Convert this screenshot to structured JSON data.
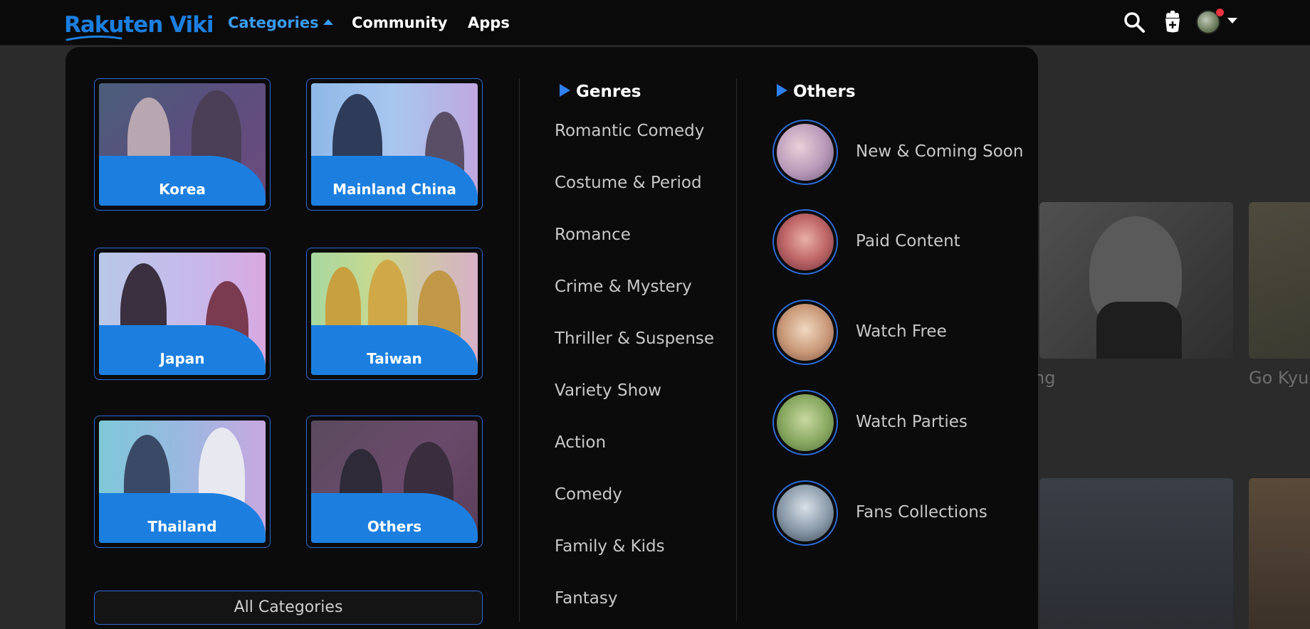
{
  "navbar": {
    "logo": "Rakuten Viki",
    "categories_label": "Categories",
    "community_label": "Community",
    "apps_label": "Apps"
  },
  "background": {
    "card_title_1": "ng",
    "card_title_2": "Go Kyu"
  },
  "countries": [
    {
      "label": "Korea"
    },
    {
      "label": "Mainland China"
    },
    {
      "label": "Japan"
    },
    {
      "label": "Taiwan"
    },
    {
      "label": "Thailand"
    },
    {
      "label": "Others"
    }
  ],
  "all_categories_label": "All Categories",
  "genres": {
    "heading": "Genres",
    "items": [
      "Romantic Comedy",
      "Costume & Period",
      "Romance",
      "Crime & Mystery",
      "Thriller & Suspense",
      "Variety Show",
      "Action",
      "Comedy",
      "Family & Kids",
      "Fantasy"
    ]
  },
  "others": {
    "heading": "Others",
    "items": [
      {
        "label": "New & Coming Soon"
      },
      {
        "label": "Paid Content"
      },
      {
        "label": "Watch Free"
      },
      {
        "label": "Watch Parties"
      },
      {
        "label": "Fans Collections"
      }
    ]
  },
  "colors": {
    "accent": "#1c7fe0",
    "nav_active": "#3a9bf0",
    "notification": "#e8323c"
  },
  "icons": {
    "search": "search-icon",
    "hat": "hat-icon",
    "avatar": "avatar"
  }
}
